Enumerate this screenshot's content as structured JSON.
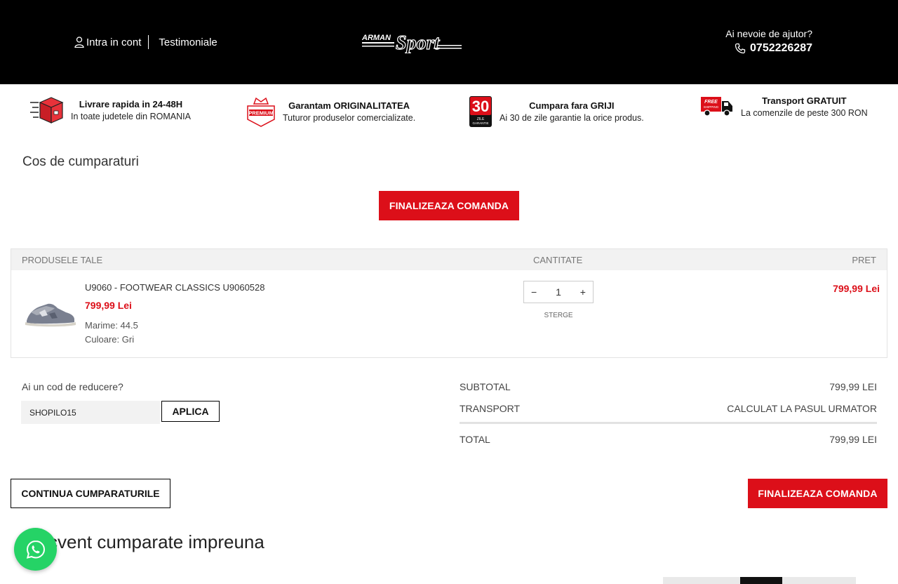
{
  "header": {
    "account_label": "Intra in cont",
    "testimonials_label": "Testimoniale",
    "logo_text_top": "ARMAN",
    "logo_text_main": "Sport",
    "help_question": "Ai nevoie de ajutor?",
    "phone": "0752226287"
  },
  "features": [
    {
      "title": "Livrare rapida in 24-48H",
      "subtitle": "In toate judetele din ROMANIA",
      "icon": "delivery-box-icon"
    },
    {
      "title": "Garantam ORIGINALITATEA",
      "subtitle": "Tuturor produselor comercializate.",
      "icon": "premium-badge-icon",
      "badge": "PREMIUM"
    },
    {
      "title": "Cumpara fara GRIJI",
      "subtitle": "Ai 30 de zile garantie la orice produs.",
      "icon": "thirty-days-icon",
      "badge_num": "30",
      "badge_line1": "ZILE",
      "badge_line2": "GARANTIE"
    },
    {
      "title": "Transport GRATUIT",
      "subtitle": "La comenzile de peste 300 RON",
      "icon": "free-shipping-truck-icon",
      "badge": "FREE",
      "badge2": "SHIPPING"
    }
  ],
  "page_title": "Cos de cumparaturi",
  "checkout_label": "FINALIZEAZA COMANDA",
  "cart": {
    "headers": {
      "products": "PRODUSELE TALE",
      "quantity": "CANTITATE",
      "price": "PRET"
    },
    "items": [
      {
        "name": "U9060 - FOOTWEAR CLASSICS U9060528",
        "price": "799,99 Lei",
        "size": "Marime: 44.5",
        "color": "Culoare: Gri",
        "quantity": "1",
        "minus": "−",
        "plus": "+",
        "remove": "STERGE",
        "line_total": "799,99 Lei"
      }
    ]
  },
  "coupon": {
    "label": "Ai un cod de reducere?",
    "value": "SHOPILO15",
    "apply": "APLICA"
  },
  "totals": {
    "subtotal_label": "SUBTOTAL",
    "subtotal": "799,99 LEI",
    "transport_label": "TRANSPORT",
    "transport": "CALCULAT LA PASUL URMATOR",
    "total_label": "TOTAL",
    "total": "799,99 LEI"
  },
  "continue_label": "CONTINUA CUMPARATURILE",
  "related_title": "Frecvent cumparate impreuna",
  "colors": {
    "accent": "#dc0f19",
    "header_bg": "#000000",
    "whatsapp": "#25d366"
  }
}
